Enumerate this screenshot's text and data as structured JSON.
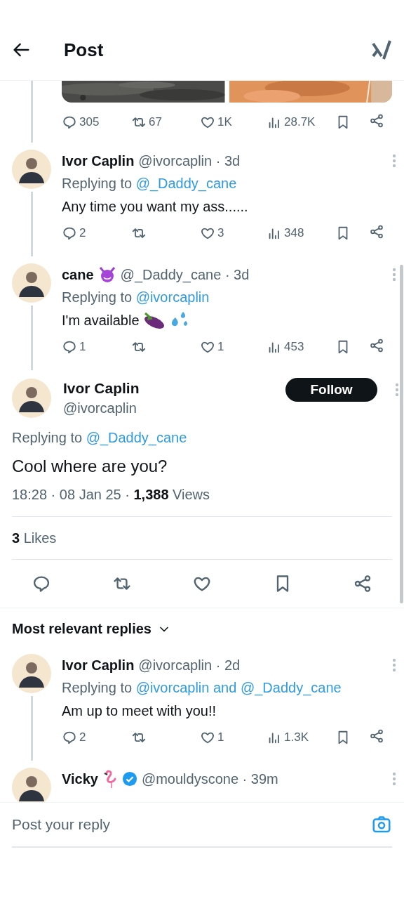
{
  "header": {
    "title": "Post"
  },
  "top_post": {
    "stats": {
      "replies": "305",
      "reposts": "67",
      "likes": "1K",
      "views": "28.7K"
    },
    "thread_below": true
  },
  "replies_above": [
    {
      "name": "Ivor Caplin",
      "verified": false,
      "byline": "@ivorcaplin · 3d",
      "replying_label": "Replying to",
      "replying_to": "@_Daddy_cane",
      "text": "Any time you want my ass......",
      "stats": {
        "replies": "2",
        "likes": "3",
        "views": "348"
      },
      "thread_below": true
    },
    {
      "name": "cane",
      "name_icons": [
        {
          "kind": "devil"
        }
      ],
      "verified": false,
      "byline": "@_Daddy_cane · 3d",
      "replying_label": "Replying to",
      "replying_to": "@ivorcaplin",
      "text": "I'm available",
      "text_icons": [
        {
          "kind": "eggplant"
        },
        {
          "kind": "droplets"
        }
      ],
      "stats": {
        "replies": "1",
        "likes": "1",
        "views": "453"
      },
      "thread_below": true
    }
  ],
  "main_post": {
    "name": "Ivor Caplin",
    "handle": "@ivorcaplin",
    "follow_button": "Follow",
    "replying_label": "Replying to",
    "replying_to": "@_Daddy_cane",
    "text": "Cool where are you?",
    "meta": "18:28 · 08 Jan 25 · **1,388** Views",
    "likes": "**3** Likes"
  },
  "replies_section": {
    "sort_label": "Most relevant replies"
  },
  "replies": [
    {
      "name": "Ivor Caplin",
      "verified": false,
      "byline": "@ivorcaplin · 2d",
      "replying_label": "Replying to",
      "replying_to": "@ivorcaplin and @_Daddy_cane",
      "text": "Am up to meet with you!!",
      "stats": {
        "replies": "2",
        "likes": "1",
        "views": "1.3K"
      },
      "thread_below": true
    },
    {
      "name": "Vicky",
      "name_icons": [
        {
          "kind": "flamingo"
        }
      ],
      "verified": true,
      "byline": "@mouldyscone · 39m",
      "thread_below": false
    }
  ],
  "reply_bar": {
    "placeholder": "Post your reply"
  }
}
